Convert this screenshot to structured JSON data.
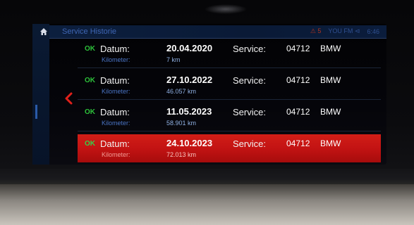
{
  "header": {
    "title": "Service Historie",
    "status_warning": "⚠ 5",
    "radio": "YOU FM ⊲",
    "clock": "6:46"
  },
  "entries": [
    {
      "ok": "OK",
      "date_label": "Datum:",
      "date": "20.04.2020",
      "service_label": "Service:",
      "code": "04712",
      "brand": "BMW",
      "km_label": "Kilometer:",
      "km": "7 km",
      "selected": false
    },
    {
      "ok": "OK",
      "date_label": "Datum:",
      "date": "27.10.2022",
      "service_label": "Service:",
      "code": "04712",
      "brand": "BMW",
      "km_label": "Kilometer:",
      "km": "46.057 km",
      "selected": false
    },
    {
      "ok": "OK",
      "date_label": "Datum:",
      "date": "11.05.2023",
      "service_label": "Service:",
      "code": "04712",
      "brand": "BMW",
      "km_label": "Kilometer:",
      "km": "58.901 km",
      "selected": false
    },
    {
      "ok": "OK",
      "date_label": "Datum:",
      "date": "24.10.2023",
      "service_label": "Service:",
      "code": "04712",
      "brand": "BMW",
      "km_label": "Kilometer:",
      "km": "72.013 km",
      "selected": true
    }
  ],
  "icons": {
    "home": "home-icon",
    "back": "chevron-left-icon"
  },
  "colors": {
    "selection": "#c81414",
    "ok": "#2dc13a",
    "header_text": "#3f66b4",
    "chevron": "#e0201a"
  }
}
